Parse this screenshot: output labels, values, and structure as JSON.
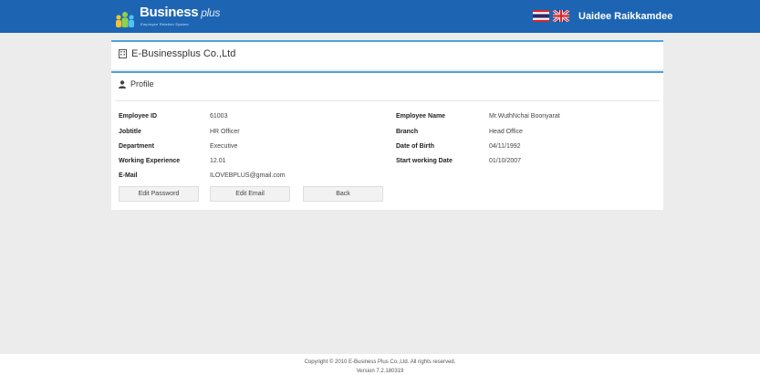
{
  "header": {
    "logo_text": "Business",
    "logo_plus": "plus",
    "logo_tagline": "Employee Relation System",
    "language_flags": [
      "thai-flag",
      "uk-flag"
    ],
    "user_name": "Uaidee Raikkamdee",
    "background_color": "#1d65b3"
  },
  "company": {
    "icon": "building-icon",
    "name": "E-Businessplus Co.,Ltd"
  },
  "profile": {
    "icon": "user-icon",
    "title": "Profile",
    "left_fields": [
      {
        "label": "Employee ID",
        "value": "61003"
      },
      {
        "label": "Jobtitle",
        "value": "HR Officer"
      },
      {
        "label": "Department",
        "value": "Executive"
      },
      {
        "label": "Working Experience",
        "value": "12.01"
      },
      {
        "label": "E-Mail",
        "value": "ILOVEBPLUS@gmail.com"
      }
    ],
    "right_fields": [
      {
        "label": "Employee Name",
        "value": "Mr.WuthNchai Boonyarat"
      },
      {
        "label": "Branch",
        "value": "Head Office"
      },
      {
        "label": "Date of Birth",
        "value": "04/11/1992"
      },
      {
        "label": "Start working Date",
        "value": "01/10/2007"
      }
    ],
    "buttons": {
      "edit_password": "Edit Password",
      "edit_email": "Edit Email",
      "back": "Back"
    }
  },
  "footer": {
    "copyright": "Copyright © 2010 E-Business Plus Co.,Ltd. All rights reserved.",
    "version": "Version 7.2.180319"
  },
  "colors": {
    "accent": "#4aa4d8",
    "page_background": "#ececec"
  }
}
